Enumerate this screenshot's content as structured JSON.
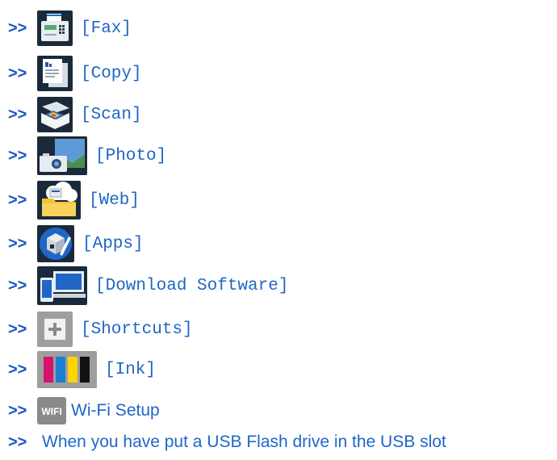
{
  "arrow_glyph": ">>",
  "link_color": "#1f66c7",
  "items": [
    {
      "label": "[Fax]",
      "icon": "fax-icon"
    },
    {
      "label": "[Copy]",
      "icon": "copy-icon"
    },
    {
      "label": "[Scan]",
      "icon": "scan-icon"
    },
    {
      "label": "[Photo]",
      "icon": "photo-icon"
    },
    {
      "label": "[Web]",
      "icon": "web-icon"
    },
    {
      "label": "[Apps]",
      "icon": "apps-icon"
    },
    {
      "label": "[Download Software]",
      "icon": "download-software-icon"
    },
    {
      "label": "[Shortcuts]",
      "icon": "shortcuts-icon"
    },
    {
      "label": "[Ink]",
      "icon": "ink-icon"
    },
    {
      "label": "Wi-Fi Setup",
      "icon": "wifi-icon",
      "icon_text": "WIFI"
    },
    {
      "label": "When you have put a USB Flash drive in the USB slot"
    }
  ]
}
